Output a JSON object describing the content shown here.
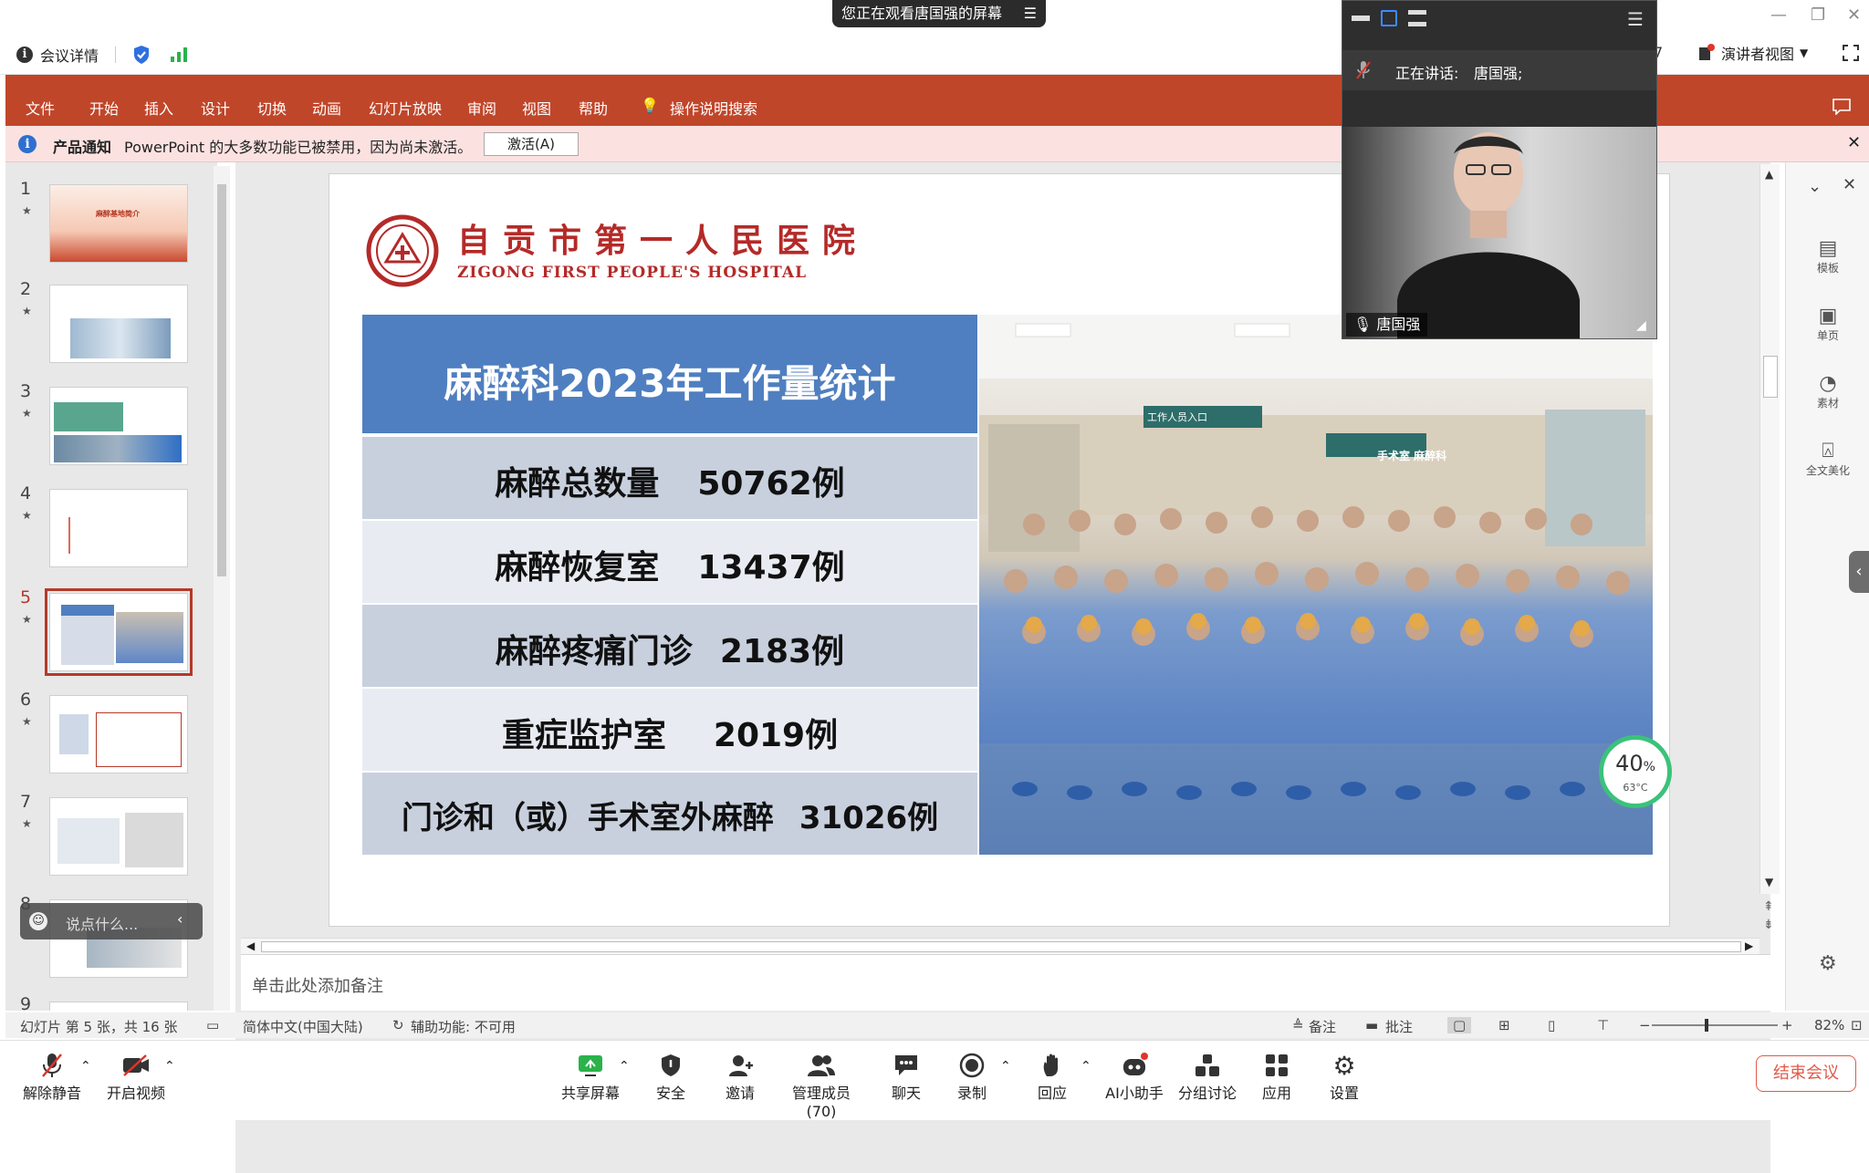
{
  "meeting": {
    "watching_banner": "您正在观看唐国强的屏幕",
    "info_label": "会议详情",
    "presenter_view": "演讲者视图",
    "hidden_digit": "7"
  },
  "ribbon": {
    "tabs": [
      "文件",
      "开始",
      "插入",
      "设计",
      "切换",
      "动画",
      "幻灯片放映",
      "审阅",
      "视图",
      "帮助"
    ],
    "search": "操作说明搜索"
  },
  "notice": {
    "title": "产品通知",
    "text": "PowerPoint 的大多数功能已被禁用，因为尚未激活。",
    "button": "激活(A)"
  },
  "thumbnails": {
    "numbers": [
      "1",
      "2",
      "3",
      "4",
      "5",
      "6",
      "7",
      "8",
      "9"
    ],
    "selected": 5,
    "thumb1_title": "麻醉基地简介"
  },
  "chat_overlay": {
    "placeholder": "说点什么..."
  },
  "slide": {
    "hospital_cn": "自贡市第一人民医院",
    "hospital_en": "ZIGONG FIRST PEOPLE'S HOSPITAL",
    "title": "麻醉科2023年工作量统计",
    "rows": [
      {
        "label": "麻醉总数量",
        "value": "50762例"
      },
      {
        "label": "麻醉恢复室",
        "value": "13437例"
      },
      {
        "label": "麻醉疼痛门诊",
        "value": "2183例"
      },
      {
        "label": "重症监护室",
        "value": "2019例"
      },
      {
        "label": "门诊和（或）手术室外麻醉",
        "value": "31026例"
      }
    ],
    "photo_sign1": "手术室 麻醉科",
    "photo_sign2": "工作人员入口",
    "badge_percent": "40",
    "badge_percent_sign": "%",
    "badge_temp": "63°C"
  },
  "notes": {
    "placeholder": "单击此处添加备注"
  },
  "statusbar": {
    "slide_info": "幻灯片 第 5 张，共 16 张",
    "language": "简体中文(中国大陆)",
    "accessibility": "辅助功能: 不可用",
    "notes_btn": "备注",
    "comments_btn": "批注",
    "zoom": "82%"
  },
  "speaker": {
    "speaking_label": "正在讲话:",
    "speaking_name": "唐国强;",
    "video_name": "唐国强"
  },
  "right_pane": {
    "items": [
      "模板",
      "单页",
      "素材",
      "全文美化"
    ]
  },
  "toolbar": {
    "unmute": "解除静音",
    "video": "开启视频",
    "share": "共享屏幕",
    "security": "安全",
    "invite": "邀请",
    "members": "管理成员(70)",
    "chat": "聊天",
    "record": "录制",
    "reaction": "回应",
    "ai": "AI小助手",
    "breakout": "分组讨论",
    "apps": "应用",
    "settings": "设置",
    "end": "结束会议"
  },
  "colors": {
    "ribbon": "#c0462a",
    "slide_title_bg": "#4f7fc0",
    "stat_row_dark": "#c8d0de",
    "stat_row_light": "#e8ecf2",
    "end_button": "#e05a4a",
    "selected_thumb": "#b33a2a"
  }
}
